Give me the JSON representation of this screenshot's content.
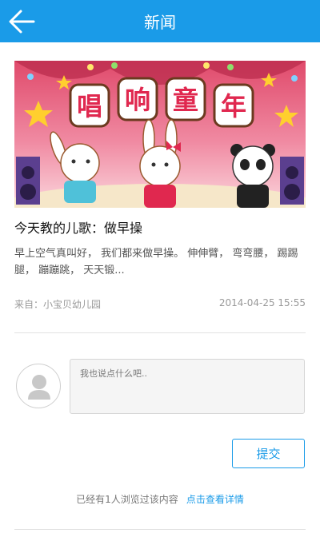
{
  "header": {
    "title": "新闻",
    "back_icon": "arrow-left-icon",
    "background": "#1a9be8"
  },
  "banner": {
    "title_chars": [
      "唱",
      "响",
      "童",
      "年"
    ]
  },
  "article": {
    "title": "今天教的儿歌：做早操",
    "summary": "早上空气真叫好， 我们都来做早操。 伸伸臂， 弯弯腰， 踢踢腿， 蹦蹦跳， 天天锻...",
    "source": "来自：小宝贝幼儿园",
    "date": "2014-04-25 15:55"
  },
  "comment": {
    "placeholder": "我也说点什么吧..",
    "submit_label": "提交",
    "avatar_icon": "default-user-avatar-icon"
  },
  "views": {
    "text": "已经有1人浏览过该内容",
    "link": "点击查看详情"
  },
  "colors": {
    "accent": "#1a9be8",
    "divider": "#e1e1e1"
  }
}
